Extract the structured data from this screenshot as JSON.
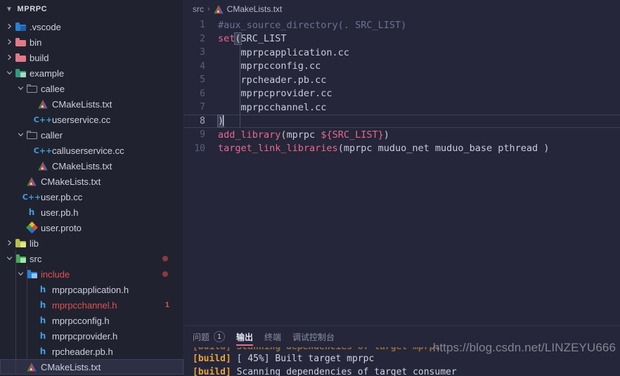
{
  "sidebar": {
    "title": "MPRPC",
    "title_chevron": "chevron-down",
    "items": [
      {
        "label": ".vscode",
        "indent": 1,
        "type": "folder",
        "state": "collapsed",
        "icon": "folder-vscode-icon",
        "color": "#2a7fd4"
      },
      {
        "label": "bin",
        "indent": 1,
        "type": "folder",
        "state": "collapsed",
        "icon": "folder-bin-icon",
        "color": "#e07a87"
      },
      {
        "label": "build",
        "indent": 1,
        "type": "folder",
        "state": "collapsed",
        "icon": "folder-build-icon",
        "color": "#e07a87"
      },
      {
        "label": "example",
        "indent": 1,
        "type": "folder",
        "state": "expanded",
        "icon": "folder-example-icon",
        "color": "#2e9c7c"
      },
      {
        "label": "callee",
        "indent": 2,
        "type": "folder",
        "state": "expanded",
        "icon": "folder-generic-icon",
        "color": "#8f94a8"
      },
      {
        "label": "CMakeLists.txt",
        "indent": 3,
        "type": "file",
        "icon": "cmake-icon"
      },
      {
        "label": "userservice.cc",
        "indent": 3,
        "type": "file",
        "icon": "cpp-icon"
      },
      {
        "label": "caller",
        "indent": 2,
        "type": "folder",
        "state": "expanded",
        "icon": "folder-generic-icon",
        "color": "#8f94a8"
      },
      {
        "label": "calluserservice.cc",
        "indent": 3,
        "type": "file",
        "icon": "cpp-icon"
      },
      {
        "label": "CMakeLists.txt",
        "indent": 3,
        "type": "file",
        "icon": "cmake-icon"
      },
      {
        "label": "CMakeLists.txt",
        "indent": 2,
        "type": "file",
        "icon": "cmake-icon"
      },
      {
        "label": "user.pb.cc",
        "indent": 2,
        "type": "file",
        "icon": "cpp-icon"
      },
      {
        "label": "user.pb.h",
        "indent": 2,
        "type": "file",
        "icon": "header-icon"
      },
      {
        "label": "user.proto",
        "indent": 2,
        "type": "file",
        "icon": "proto-icon"
      },
      {
        "label": "lib",
        "indent": 1,
        "type": "folder",
        "state": "collapsed",
        "icon": "folder-lib-icon",
        "color": "#b8bf46"
      },
      {
        "label": "src",
        "indent": 1,
        "type": "folder",
        "state": "expanded",
        "icon": "folder-src-icon",
        "color": "#4aa85a",
        "error_dot": true
      },
      {
        "label": "include",
        "indent": 2,
        "type": "folder",
        "state": "expanded",
        "icon": "folder-include-icon",
        "color": "#2a7fd4",
        "error_dot": true,
        "error_label": true
      },
      {
        "label": "mprpcapplication.h",
        "indent": 3,
        "type": "file",
        "icon": "header-icon"
      },
      {
        "label": "mprpcchannel.h",
        "indent": 3,
        "type": "file",
        "icon": "header-icon",
        "error_label": true,
        "badge": "1"
      },
      {
        "label": "mprpcconfig.h",
        "indent": 3,
        "type": "file",
        "icon": "header-icon"
      },
      {
        "label": "mprpcprovider.h",
        "indent": 3,
        "type": "file",
        "icon": "header-icon"
      },
      {
        "label": "rpcheader.pb.h",
        "indent": 3,
        "type": "file",
        "icon": "header-icon"
      },
      {
        "label": "CMakeLists.txt",
        "indent": 2,
        "type": "file",
        "icon": "cmake-icon",
        "selected": true
      }
    ]
  },
  "breadcrumb": {
    "folder": "src",
    "separator": "›",
    "file": "CMakeLists.txt",
    "file_icon": "cmake-icon"
  },
  "editor": {
    "lines": [
      {
        "n": "1",
        "tokens": [
          {
            "t": "#aux_source_directory(. SRC_LIST)",
            "c": "tok-cmt"
          }
        ]
      },
      {
        "n": "2",
        "tokens": [
          {
            "t": "set",
            "c": "tok-cmd"
          },
          {
            "t": "(",
            "c": "bracket-hl"
          },
          {
            "t": "SRC_LIST",
            "c": "tok-arg"
          }
        ]
      },
      {
        "n": "3",
        "tokens": [
          {
            "t": "    mprpcapplication.cc",
            "c": "tok-arg"
          }
        ]
      },
      {
        "n": "4",
        "tokens": [
          {
            "t": "    mprpcconfig.cc",
            "c": "tok-arg"
          }
        ]
      },
      {
        "n": "5",
        "tokens": [
          {
            "t": "    rpcheader.pb.cc",
            "c": "tok-arg"
          }
        ]
      },
      {
        "n": "6",
        "tokens": [
          {
            "t": "    mprpcprovider.cc",
            "c": "tok-arg"
          }
        ]
      },
      {
        "n": "7",
        "tokens": [
          {
            "t": "    mprpcchannel.cc",
            "c": "tok-arg"
          }
        ]
      },
      {
        "n": "8",
        "active": true,
        "caret": true,
        "tokens": [
          {
            "t": ")",
            "c": "bracket-hl"
          }
        ]
      },
      {
        "n": "9",
        "tokens": [
          {
            "t": "add_library",
            "c": "tok-cmd"
          },
          {
            "t": "(mprpc ",
            "c": "tok-arg"
          },
          {
            "t": "${SRC_LIST}",
            "c": "tok-var"
          },
          {
            "t": ")",
            "c": "tok-arg"
          }
        ]
      },
      {
        "n": "10",
        "tokens": [
          {
            "t": "target_link_libraries",
            "c": "tok-cmd"
          },
          {
            "t": "(mprpc muduo_net muduo_base pthread )",
            "c": "tok-arg"
          }
        ]
      }
    ]
  },
  "panel": {
    "tabs": [
      {
        "label": "问题",
        "badge": "1",
        "active": false
      },
      {
        "label": "输出",
        "active": true
      },
      {
        "label": "终端",
        "active": false
      },
      {
        "label": "调试控制台",
        "active": false
      }
    ],
    "output_lines": [
      {
        "clipped": true,
        "tag": "",
        "text": ""
      },
      {
        "tag": "[build]",
        "text": " [ 45%] Built target mprpc"
      },
      {
        "tag": "[build]",
        "text": " Scanning dependencies of target consumer"
      }
    ]
  },
  "watermark": "https://blog.csdn.net/LINZEYU666"
}
